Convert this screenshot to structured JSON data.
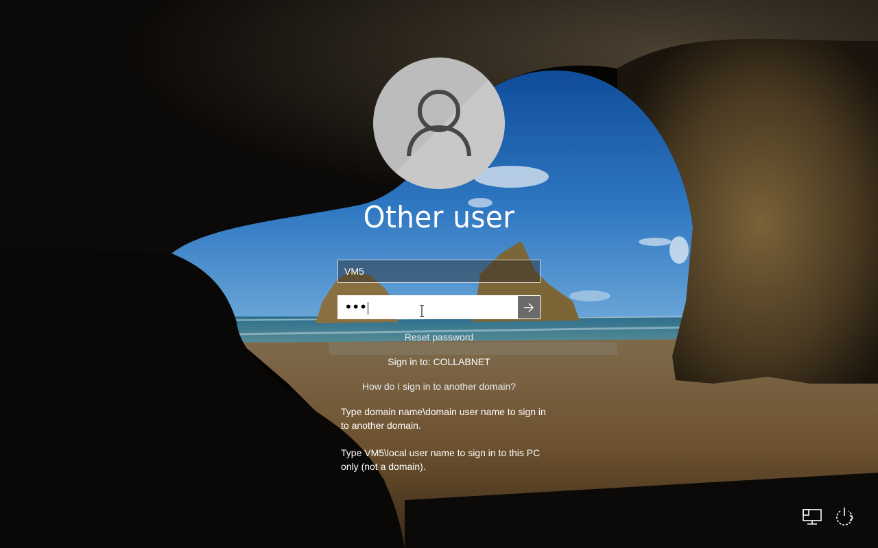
{
  "user": {
    "title": "Other user",
    "avatar_icon": "user-silhouette-icon"
  },
  "form": {
    "username_value": "VM5",
    "password_masked": "•••",
    "submit_icon": "arrow-right-icon"
  },
  "links": {
    "reset_password": "Reset password",
    "sign_in_to": "Sign in to: COLLABNET",
    "other_domain_help": "How do I sign in to another domain?"
  },
  "hints": {
    "domain_hint": "Type domain name\\domain user name to sign in to another domain.",
    "local_hint": "Type VM5\\local user name to sign in to this PC only (not a domain)."
  },
  "corner": {
    "network_icon": "network-icon",
    "power_icon": "power-icon"
  },
  "colors": {
    "sky": "#2d6fb6",
    "sea": "#3f8aa0",
    "sand": "#8a6a3c",
    "cave": "#0b0907",
    "submit_bg": "#6b6b6b"
  }
}
